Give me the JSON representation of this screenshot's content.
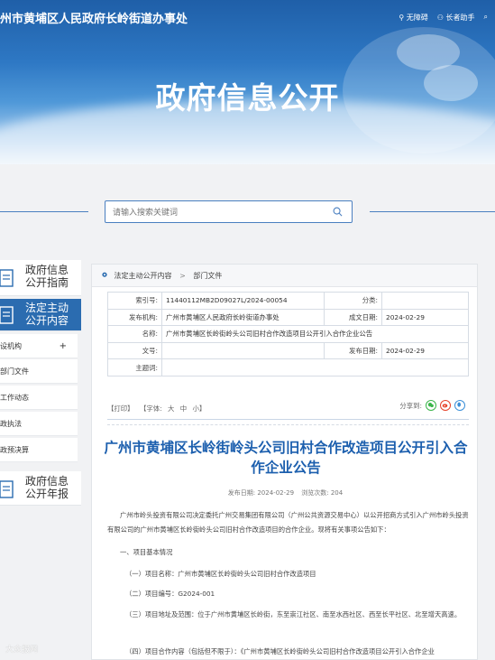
{
  "header": {
    "site_title": "州市黄埔区人民政府长岭街道办事处",
    "tools": [
      {
        "icon": "accessibility-icon",
        "label": "无障碍"
      },
      {
        "icon": "elder-icon",
        "label": "长者助手"
      },
      {
        "icon": "search-icon",
        "label": ""
      }
    ],
    "banner_title": "政府信息公开"
  },
  "search": {
    "placeholder": "请输入搜索关键词"
  },
  "sidebar": {
    "guide": {
      "line1": "政府信息",
      "line2": "公开指南"
    },
    "active": {
      "line1": "法定主动",
      "line2": "公开内容"
    },
    "items": [
      {
        "label": "设机构",
        "has_plus": "+"
      },
      {
        "label": "部门文件",
        "has_plus": ""
      },
      {
        "label": "工作动态",
        "has_plus": ""
      },
      {
        "label": "政执法",
        "has_plus": ""
      },
      {
        "label": "政预决算",
        "has_plus": ""
      }
    ],
    "report": {
      "line1": "政府信息",
      "line2": "公开年报"
    }
  },
  "breadcrumb": {
    "part1": "法定主动公开内容",
    "separator": ">",
    "part2": "部门文件"
  },
  "meta": {
    "index_key": "索引号:",
    "index_val": "11440112MB2D09027L/2024-00054",
    "category_key": "分类:",
    "category_val": "",
    "publisher_key": "发布机构:",
    "publisher_val": "广州市黄埔区人民政府长岭街道办事处",
    "date_key": "成文日期:",
    "date_val": "2024-02-29",
    "name_key": "名称:",
    "name_val": "广州市黄埔区长岭街岭头公司旧村合作改造项目公开引入合作企业公告",
    "docno_key": "文号:",
    "docno_val": "",
    "pubdate_key": "发布日期:",
    "pubdate_val": "2024-02-29",
    "subject_key": "主题词:",
    "subject_val": ""
  },
  "toolbar": {
    "print": "【打印】",
    "font_label": "【字体:",
    "font_big": "大",
    "font_mid": "中",
    "font_small": "小】",
    "share_label": "分享到:"
  },
  "article": {
    "title": "广州市黄埔区长岭街岭头公司旧村合作改造项目公开引入合作企业公告",
    "pub_date_label": "发布日期: 2024-02-29",
    "views_label": "浏览次数: 204",
    "paragraphs": [
      "广州市岭头投资有限公司决定委托广州交易集团有限公司（广州公共资源交易中心）以公开招商方式引入广州市岭头投资有限公司的广州市黄埔区长岭街岭头公司旧村合作改造项目的合作企业。现将有关事项公告如下：",
      "一、项目基本情况",
      "（一）项目名称：广州市黄埔区长岭街岭头公司旧村合作改造项目",
      "（二）项目编号：G2024-001",
      "（三）项目地址及范围：位于广州市黄埔区长岭街，东至崇江社区、南至水西社区、西至长平社区、北至增天高速。",
      "（四）项目合作内容（包括但不限于）：《广州市黄埔区长岭街岭头公司旧村合作改造项目公开引入合作企业"
    ]
  },
  "watermark": "大众报网",
  "colors": {
    "brand_blue": "#2b6cb0",
    "title_blue": "#1c5fae",
    "wechat_green": "#3bb54a",
    "weibo_red": "#e6432b",
    "qq_blue": "#3a8fd8"
  }
}
